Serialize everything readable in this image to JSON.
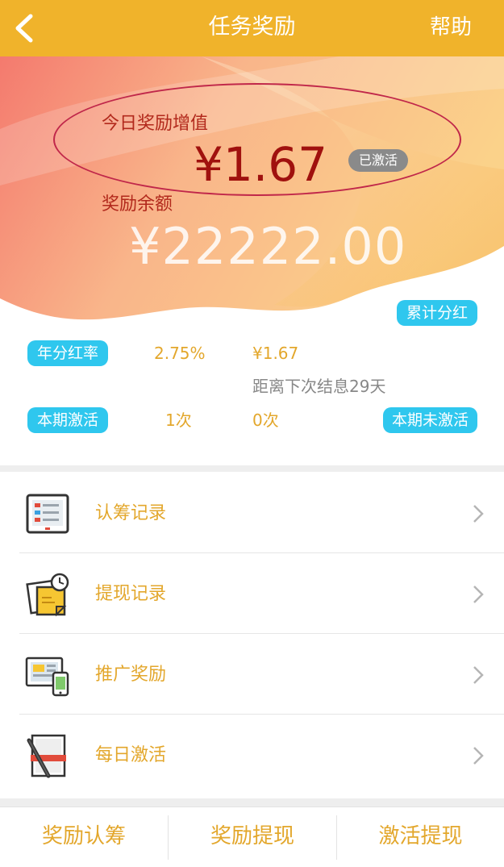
{
  "nav": {
    "title": "任务奖励",
    "help": "帮助"
  },
  "hero": {
    "today_label": "今日奖励增值",
    "today_amount": "¥1.67",
    "activated_badge": "已激活",
    "balance_label": "奖励余额",
    "balance_amount": "¥22222.00"
  },
  "stats": {
    "cumulative_label": "累计分红",
    "annual_rate_label": "年分红率",
    "annual_rate_value": "2.75%",
    "cumulative_value": "¥1.67",
    "next_interest": "距离下次结息29天",
    "period_active_label": "本期激活",
    "period_active_count": "1次",
    "period_inactive_count": "0次",
    "period_inactive_label": "本期未激活"
  },
  "menu": [
    {
      "label": "认筹记录",
      "icon": "tablet-icon"
    },
    {
      "label": "提现记录",
      "icon": "note-clock-icon"
    },
    {
      "label": "推广奖励",
      "icon": "devices-icon"
    },
    {
      "label": "每日激活",
      "icon": "notebook-pen-icon"
    }
  ],
  "tabs": [
    "奖励认筹",
    "奖励提现",
    "激活提现"
  ],
  "colors": {
    "primary": "#f0b32b",
    "accent_blue": "#2fc7ee",
    "text_orange": "#e3a72c",
    "amount_red": "#a0110e"
  }
}
